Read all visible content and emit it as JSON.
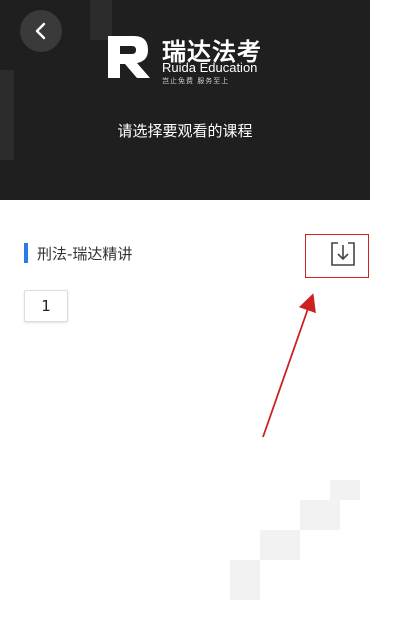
{
  "header": {
    "brand_cn": "瑞达法考",
    "brand_en": "Ruida Education",
    "brand_slogan": "岂止免费  服务至上",
    "logo_letter": "R",
    "prompt": "请选择要观看的课程"
  },
  "course": {
    "title": "刑法-瑞达精讲",
    "accent_color": "#2a7be4"
  },
  "episodes": [
    "1"
  ],
  "annotation": {
    "highlight_color": "#cc2222",
    "target": "download-button"
  }
}
